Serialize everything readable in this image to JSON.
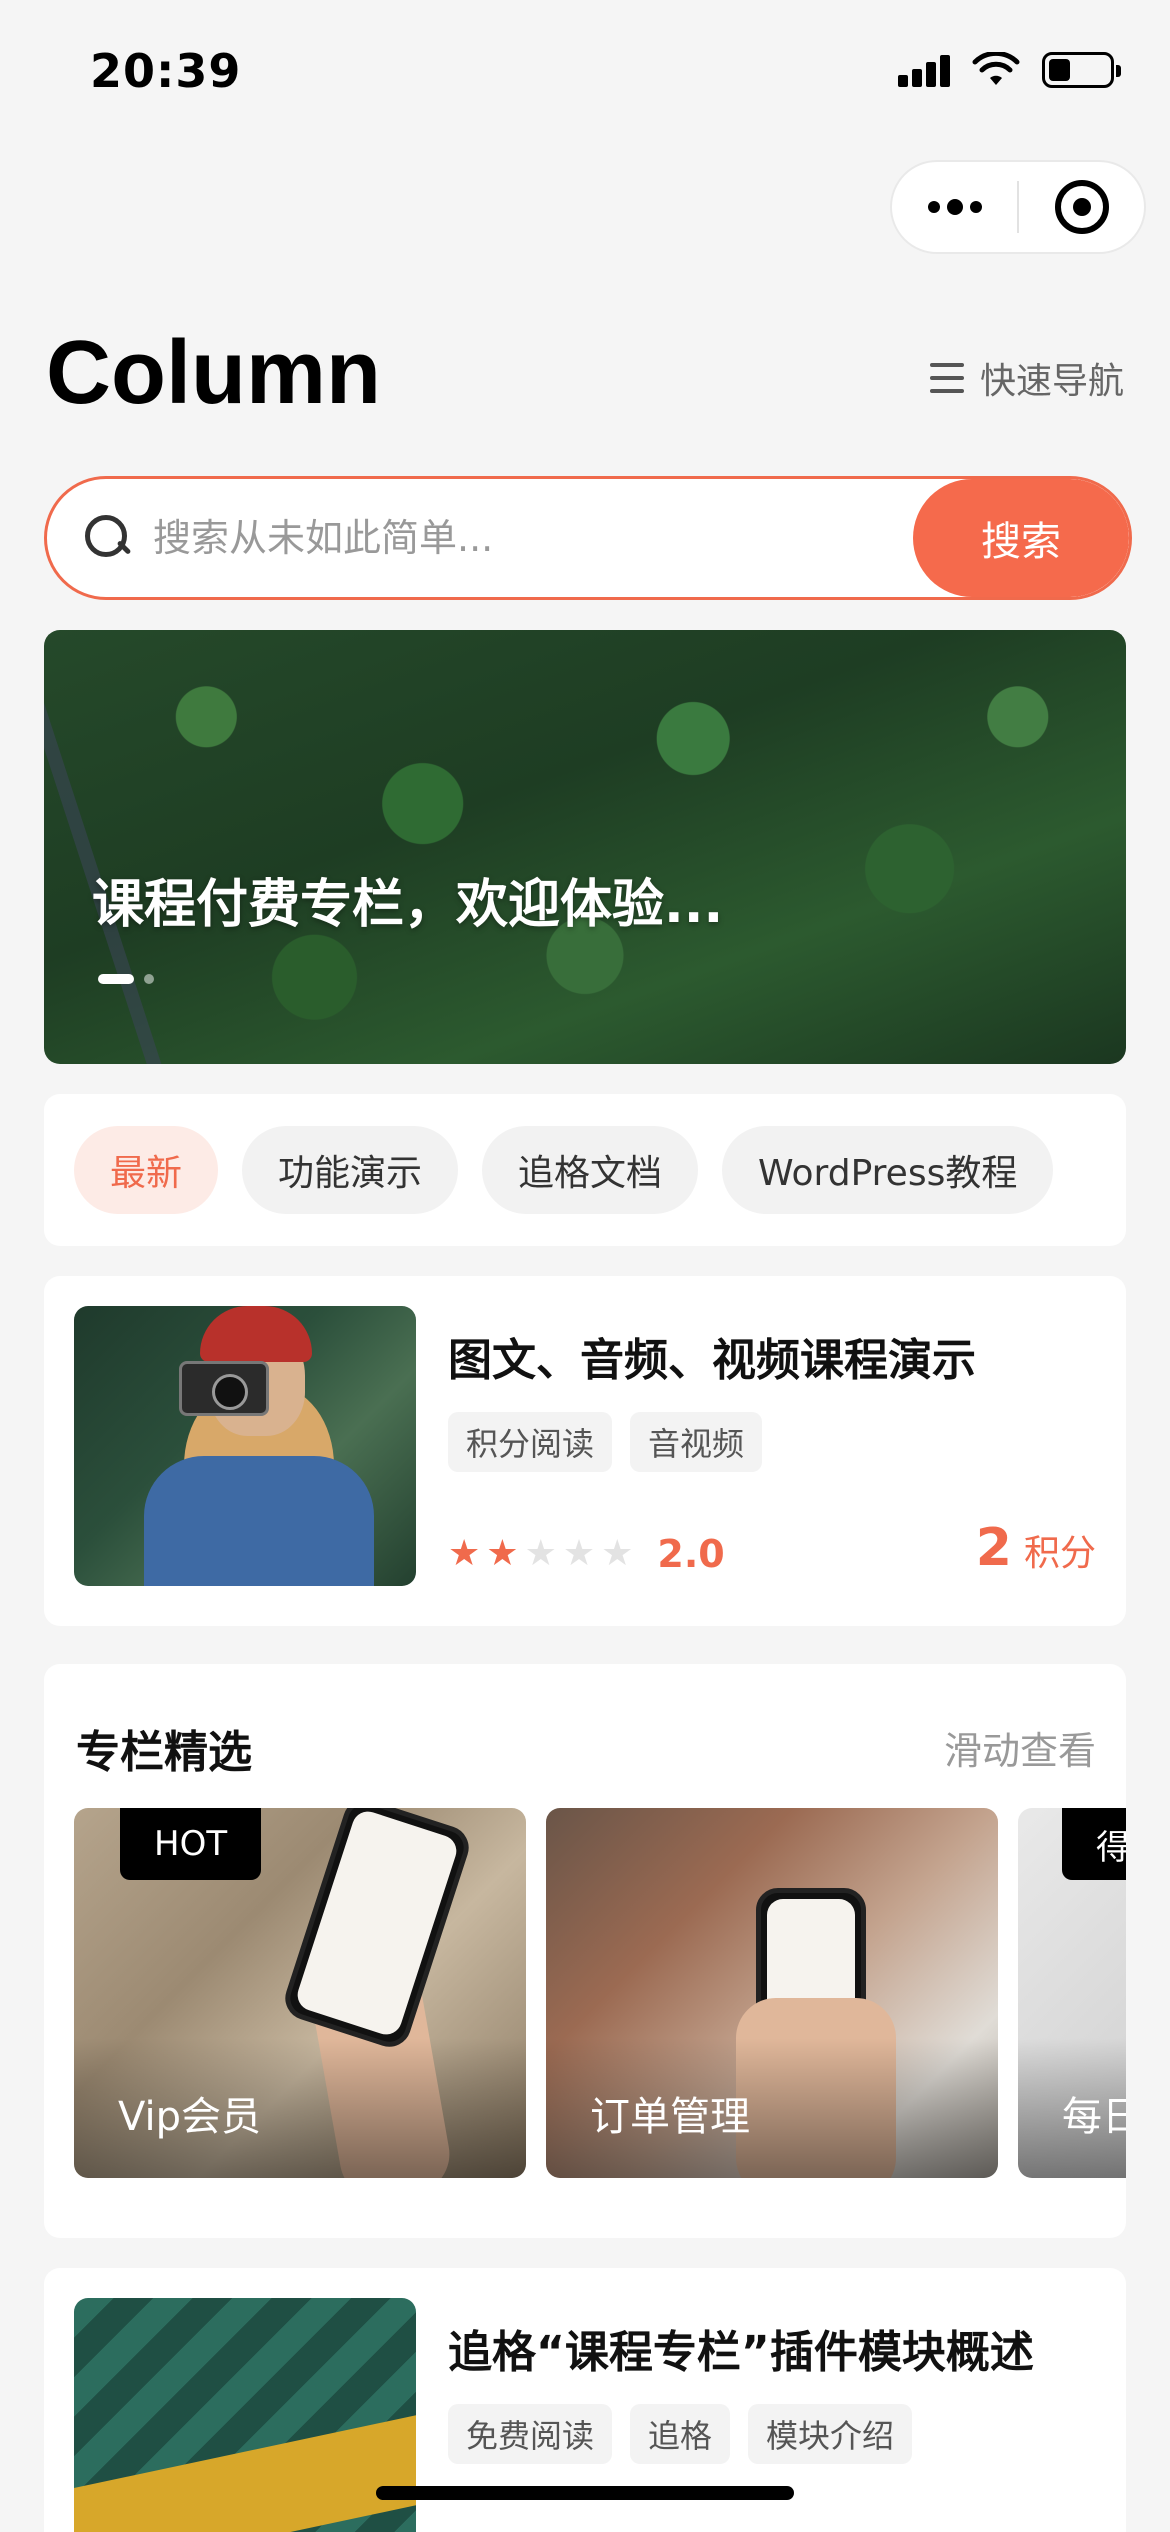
{
  "status_bar": {
    "time": "20:39"
  },
  "header": {
    "title": "Column",
    "quick_nav_label": "快速导航"
  },
  "search": {
    "placeholder": "搜索从未如此简单...",
    "button_label": "搜索"
  },
  "banner": {
    "title": "课程付费专栏，欢迎体验..."
  },
  "tabs": [
    {
      "label": "最新",
      "active": true
    },
    {
      "label": "功能演示"
    },
    {
      "label": "追格文档"
    },
    {
      "label": "WordPress教程"
    }
  ],
  "articles": [
    {
      "title": "图文、音频、视频课程演示",
      "tags": [
        "积分阅读",
        "音视频"
      ],
      "rating": 2,
      "rating_value": "2.0",
      "points": "2",
      "points_unit": "积分"
    },
    {
      "title": "追格“课程专栏”插件模块概述",
      "tags": [
        "免费阅读",
        "追格",
        "模块介绍"
      ]
    }
  ],
  "featured": {
    "title": "专栏精选",
    "hint": "滑动查看",
    "cards": [
      {
        "label": "Vip会员",
        "badge": "HOT"
      },
      {
        "label": "订单管理",
        "badge": ""
      },
      {
        "label": "每日",
        "badge": "得"
      }
    ]
  },
  "colors": {
    "accent": "#f56a4c",
    "accent_light": "#fdebe6",
    "background": "#f5f5f5"
  }
}
